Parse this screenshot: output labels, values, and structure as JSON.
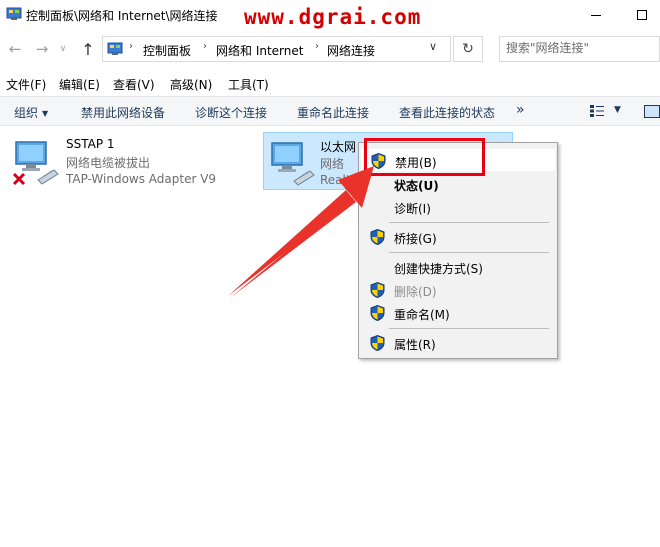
{
  "window": {
    "title": "控制面板\\网络和 Internet\\网络连接",
    "watermark": "www.dgrai.com"
  },
  "address": {
    "crumbs": [
      "控制面板",
      "网络和 Internet",
      "网络连接"
    ],
    "search_placeholder": "搜索\"网络连接\""
  },
  "menubar": {
    "items": [
      "文件(F)",
      "编辑(E)",
      "查看(V)",
      "高级(N)",
      "工具(T)"
    ]
  },
  "commandbar": {
    "organize": "组织",
    "items": [
      "禁用此网络设备",
      "诊断这个连接",
      "重命名此连接",
      "查看此连接的状态"
    ],
    "more": "»"
  },
  "connections": [
    {
      "name": "SSTAP 1",
      "status": "网络电缆被拔出",
      "device": "TAP-Windows Adapter V9"
    },
    {
      "name": "以太网",
      "status": "网络",
      "device": "Realtek"
    }
  ],
  "context_menu": {
    "items": [
      {
        "label": "禁用(B)",
        "shield": true
      },
      {
        "label": "状态(U)",
        "bold": true
      },
      {
        "label": "诊断(I)"
      },
      {
        "label": "桥接(G)",
        "shield": true
      },
      {
        "label": "创建快捷方式(S)"
      },
      {
        "label": "删除(D)",
        "shield": true,
        "disabled": true
      },
      {
        "label": "重命名(M)",
        "shield": true
      },
      {
        "label": "属性(R)",
        "shield": true
      }
    ]
  },
  "colors": {
    "highlight": "#e60012",
    "selection": "#cce8ff",
    "watermark": "#d40000"
  }
}
